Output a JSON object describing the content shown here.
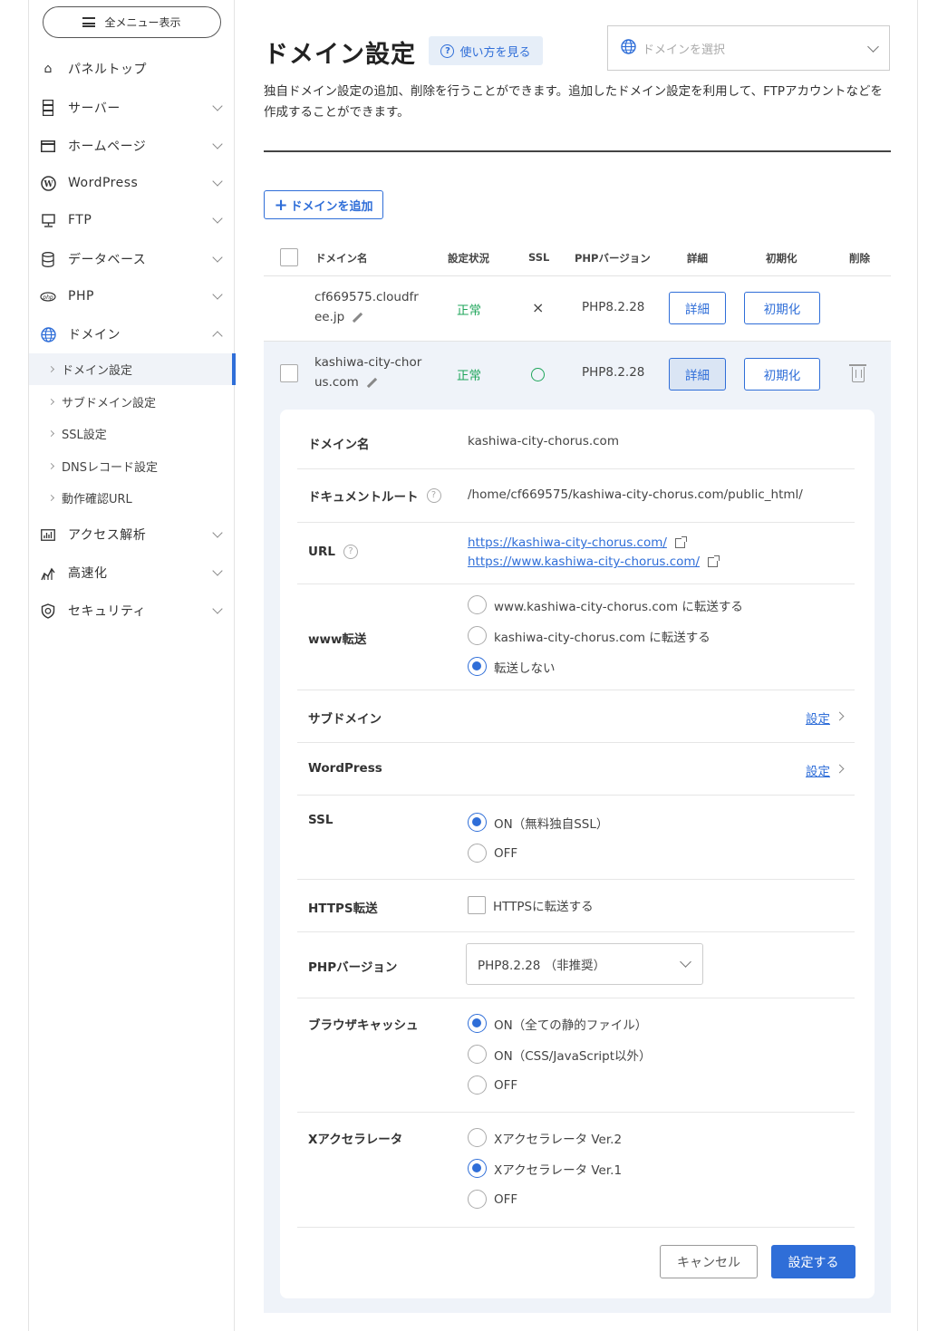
{
  "sidebar": {
    "menu_button": "全メニュー表示",
    "items": [
      {
        "label": "パネルトップ",
        "icon": "home-icon"
      },
      {
        "label": "サーバー",
        "icon": "server-icon"
      },
      {
        "label": "ホームページ",
        "icon": "browser-window-icon"
      },
      {
        "label": "WordPress",
        "icon": "wordpress-icon"
      },
      {
        "label": "FTP",
        "icon": "monitor-icon"
      },
      {
        "label": "データベース",
        "icon": "database-icon"
      },
      {
        "label": "PHP",
        "icon": "php-icon"
      },
      {
        "label": "ドメイン",
        "icon": "globe-icon"
      },
      {
        "label": "アクセス解析",
        "icon": "analytics-icon"
      },
      {
        "label": "高速化",
        "icon": "speed-icon"
      },
      {
        "label": "セキュリティ",
        "icon": "shield-icon"
      }
    ],
    "sub_items": [
      {
        "label": "ドメイン設定"
      },
      {
        "label": "サブドメイン設定"
      },
      {
        "label": "SSL設定"
      },
      {
        "label": "DNSレコード設定"
      },
      {
        "label": "動作確認URL"
      }
    ]
  },
  "header": {
    "title": "ドメイン設定",
    "howto": "使い方を見る",
    "domain_select_placeholder": "ドメインを選択",
    "description": "独自ドメイン設定の追加、削除を行うことができます。追加したドメイン設定を利用して、FTPアカウントなどを作成することができます。"
  },
  "add_button": "ドメインを追加",
  "table": {
    "headers": [
      "ドメイン名",
      "設定状況",
      "SSL",
      "PHPバージョン",
      "詳細",
      "初期化",
      "削除"
    ],
    "rows": [
      {
        "domain": "cf669575.cloudfree.jp",
        "status": "正常",
        "ssl": "×",
        "php": "PHP8.2.28",
        "detail": "詳細",
        "reset": "初期化"
      },
      {
        "domain": "kashiwa-city-chorus.com",
        "status": "正常",
        "ssl": "◯",
        "php": "PHP8.2.28",
        "detail": "詳細",
        "reset": "初期化"
      }
    ]
  },
  "detail": {
    "domain_label": "ドメイン名",
    "domain_value": "kashiwa-city-chorus.com",
    "docroot_label": "ドキュメントルート",
    "docroot_value": "/home/cf669575/kashiwa-city-chorus.com/public_html/",
    "url_label": "URL",
    "url1": "https://kashiwa-city-chorus.com/",
    "url2": "https://www.kashiwa-city-chorus.com/",
    "www_label": "www転送",
    "www_options": [
      "www.kashiwa-city-chorus.com に転送する",
      "kashiwa-city-chorus.com に転送する",
      "転送しない"
    ],
    "subdomain_label": "サブドメイン",
    "wordpress_label": "WordPress",
    "set_link": "設定",
    "ssl_label": "SSL",
    "ssl_options": [
      "ON（無料独自SSL）",
      "OFF"
    ],
    "https_label": "HTTPS転送",
    "https_checkbox": "HTTPSに転送する",
    "php_label": "PHPバージョン",
    "php_value": "PHP8.2.28 （非推奨）",
    "cache_label": "ブラウザキャッシュ",
    "cache_options": [
      "ON（全ての静的ファイル）",
      "ON（CSS/JavaScript以外）",
      "OFF"
    ],
    "xaccel_label": "Xアクセラレータ",
    "xaccel_options": [
      "Xアクセラレータ Ver.2",
      "Xアクセラレータ Ver.1",
      "OFF"
    ],
    "cancel": "キャンセル",
    "submit": "設定する"
  },
  "colors": {
    "accent": "#2f6ed8",
    "ok": "#1ea55a",
    "row_highlight": "#eff3f9"
  }
}
